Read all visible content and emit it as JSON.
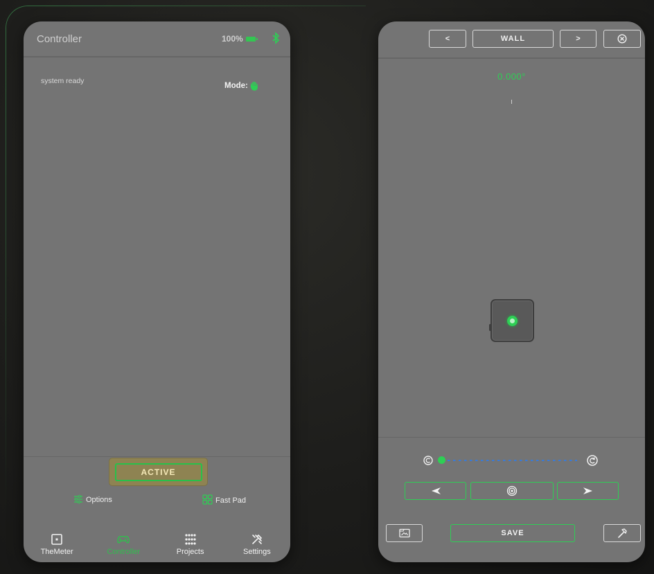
{
  "colors": {
    "accent": "#2ecf55",
    "panel": "#747474",
    "active_bg": "#8e8352",
    "active_text": "#f5e9b8"
  },
  "left": {
    "header": {
      "title": "Controller",
      "battery": "100%",
      "battery_icon": "battery-full-icon",
      "bt_icon": "bluetooth-icon"
    },
    "status": "system ready",
    "mode": {
      "label": "Mode:",
      "icon": "hand-icon"
    },
    "active_button": "ACTIVE",
    "options_label": "Options",
    "fastpad_label": "Fast Pad",
    "tabs": [
      {
        "label": "TheMeter",
        "icon": "meter-icon",
        "selected": false
      },
      {
        "label": "Controller",
        "icon": "gamepad-icon",
        "selected": true
      },
      {
        "label": "Projects",
        "icon": "grid-dots-icon",
        "selected": false
      },
      {
        "label": "Settings",
        "icon": "tools-icon",
        "selected": false
      }
    ]
  },
  "right": {
    "header": {
      "prev": "<",
      "title": "WALL",
      "next": ">",
      "close_icon": "close-icon"
    },
    "angle": "0.000°",
    "slider": {
      "value": 0.0
    },
    "save_label": "SAVE"
  }
}
